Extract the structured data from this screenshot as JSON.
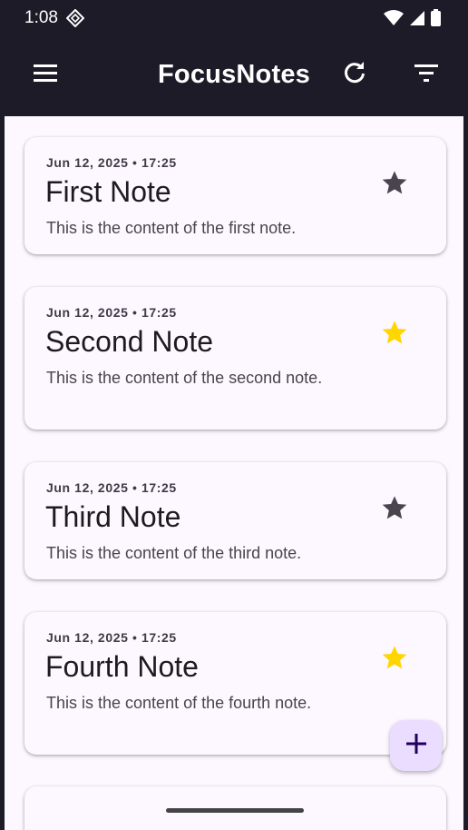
{
  "status": {
    "time": "1:08"
  },
  "app": {
    "title": "FocusNotes"
  },
  "notes": [
    {
      "date": "Jun 12, 2025 • 17:25",
      "title": "First Note",
      "content": "This is the content of the first note.",
      "starred": false
    },
    {
      "date": "Jun 12, 2025 • 17:25",
      "title": "Second Note",
      "content": "This is the content of the second note.",
      "starred": true
    },
    {
      "date": "Jun 12, 2025 • 17:25",
      "title": "Third Note",
      "content": "This is the content of the third note.",
      "starred": false
    },
    {
      "date": "Jun 12, 2025 • 17:25",
      "title": "Fourth Note",
      "content": "This is the content of the fourth note.",
      "starred": true
    }
  ],
  "colors": {
    "appbar": "#1d1b28",
    "background": "#fdf7ff",
    "star_active": "#ffd600",
    "star_inactive": "#49454f",
    "fab": "#eaddff"
  },
  "icons": {
    "menu": "menu-icon",
    "refresh": "refresh-icon",
    "filter": "filter-icon",
    "star": "star-icon",
    "add": "plus-icon"
  }
}
